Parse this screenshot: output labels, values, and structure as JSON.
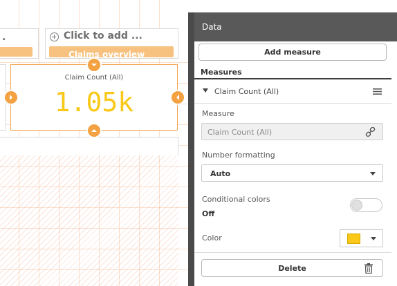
{
  "canvas": {
    "placeholder_left": {
      "title": "."
    },
    "placeholder_right": {
      "title": "Click to add ...",
      "bar_text": "Claims overview"
    },
    "kpi": {
      "label": "Claim Count (All)",
      "value": "1.05k",
      "value_color": "#f9c818",
      "accent_color": "#f4a142"
    }
  },
  "panel": {
    "header_title": "Data",
    "add_measure_label": "Add measure",
    "measures_section_title": "Measures",
    "measure_item": {
      "label": "Claim Count (All)",
      "measure_label": "Measure",
      "measure_value": "Claim Count (All)",
      "number_formatting_label": "Number formatting",
      "number_formatting_value": "Auto",
      "conditional_colors_label": "Conditional colors",
      "conditional_colors_value": "Off",
      "color_label": "Color",
      "color_value": "#f9c818"
    },
    "delete_label": "Delete"
  }
}
